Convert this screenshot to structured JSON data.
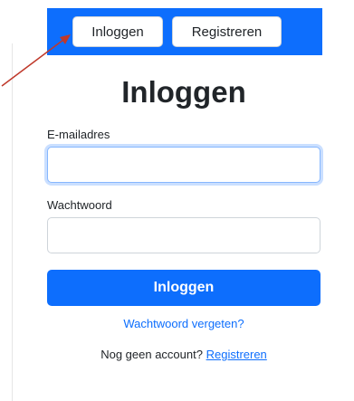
{
  "navbar": {
    "login_label": "Inloggen",
    "register_label": "Registreren",
    "background_color": "#0d6efd"
  },
  "annotation": {
    "arrow_color": "#c0392b",
    "points_to": "login-nav-button"
  },
  "form": {
    "title": "Inloggen",
    "email_label": "E-mailadres",
    "email_value": "",
    "password_label": "Wachtwoord",
    "password_value": "",
    "submit_label": "Inloggen",
    "submit_color": "#0d6efd",
    "forgot_password_label": "Wachtwoord vergeten?",
    "signup_prompt": "Nog geen account?",
    "signup_link_label": "Registreren"
  }
}
